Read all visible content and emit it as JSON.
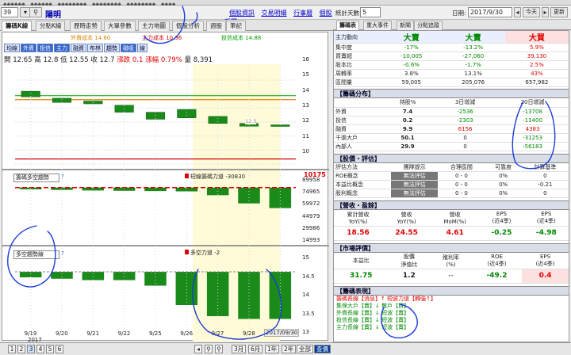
{
  "topbar": {
    "items": [
      "◆◆◆◆◆◆",
      "◆◆◆◆◆◆",
      "◆◆◆◆◆◆◆◆",
      "◆◆◆◆◆◆◆◆",
      "◆◆◆◆◆◆◆◆",
      "◆◆◆◆"
    ]
  },
  "header": {
    "code": "39",
    "stock_name": "陽明",
    "links": [
      "個股資訊",
      "交易明細",
      "行事曆",
      "個股新聞"
    ]
  },
  "left_tabs": [
    "籌碼K線",
    "分點K線",
    "歷時走勢",
    "大單參數",
    "主力地圖",
    "個股分析",
    "週股",
    "筆記"
  ],
  "legend_top": [
    {
      "label": "外資成本 14.60",
      "color": "#e08000"
    },
    {
      "label": "主力成本 10.36",
      "color": "#d00000"
    },
    {
      "label": "投信成本 14.88",
      "color": "#00a000"
    }
  ],
  "chart_buttons": [
    "均線",
    "外資",
    "投信",
    "主力",
    "融資",
    "布林",
    "趨勢",
    "磁吸",
    "線"
  ],
  "quote": {
    "open": "開 12.65",
    "high": "高 12.8",
    "low": "低 12.55",
    "close": "收 12.7",
    "change": "漲跌 0.1",
    "pct": "漲幅 0.79%",
    "vol": "量 8,391"
  },
  "panel2": {
    "select": "籌碼多空趨勢",
    "help": "?",
    "title": "短線籌碼力道 -30830",
    "maxval": "10175"
  },
  "panel3": {
    "select": "多空趨勢線",
    "help": "?",
    "title": "多空力道 -2"
  },
  "axis1": [
    "16",
    "15",
    "14",
    "13",
    "12",
    "11",
    "10"
  ],
  "axis2": [
    "89958",
    "74965",
    "59972",
    "44979",
    "29986",
    "14993"
  ],
  "axis3": [
    "15",
    "14.5",
    "14",
    "13.5",
    "13"
  ],
  "chart_label_12_5": "12.5",
  "x_dates": [
    "9/19",
    "9/20",
    "9/21",
    "9/22",
    "9/25",
    "9/26",
    "9/27",
    "9/28",
    "9/29"
  ],
  "year_label": "2017",
  "end_date_label": "2017/09/30",
  "pages": [
    "1",
    "2",
    "3",
    "4",
    "5",
    "6"
  ],
  "ranges": [
    "3月",
    "6月",
    "1年",
    "2年",
    "全部",
    "查價"
  ],
  "right_top": {
    "label": "統計天數:",
    "days": "5",
    "date_label": "日期:",
    "date": "2017/9/30",
    "today": "今天",
    "refresh": "更新"
  },
  "right_tabs": [
    "籌碼表",
    "重大事件",
    "新聞",
    "分點追蹤"
  ],
  "summary": {
    "header": [
      "主力動向",
      "大賣",
      "大賣",
      "大買"
    ],
    "rows": [
      [
        "集中度",
        "-17%",
        "-13.2%",
        "5.9%"
      ],
      [
        "買賣超",
        "-10,005",
        "-27,060",
        "39,130"
      ],
      [
        "股本比",
        "-0.6%",
        "-1.7%",
        "2.5%"
      ],
      [
        "周轉率",
        "3.8%",
        "13.1%",
        "43%"
      ],
      [
        "區間量",
        "59,005",
        "205,076",
        "657,982"
      ]
    ]
  },
  "chip_dist": {
    "title": "【籌碼分布】",
    "cols": [
      "",
      "持股%",
      "3日增減",
      "20日增減"
    ],
    "rows": [
      [
        "外資",
        "7.4",
        "-2536",
        "-13708"
      ],
      [
        "投信",
        "0.2",
        "-2303",
        "-11400"
      ],
      [
        "融資",
        "9.9",
        "6156",
        "4383"
      ],
      [
        "千張大戶",
        "50.1",
        "0",
        "-31253"
      ],
      [
        "內部人",
        "29.9",
        "0",
        "-56183"
      ]
    ]
  },
  "eval": {
    "title": "【股價・評估】",
    "cols": [
      "評估方法",
      "團隊提示",
      "合理區間",
      "可靠度",
      "計算基準"
    ],
    "rows": [
      [
        "ROE概念",
        "無法評估",
        "0 - 0",
        "0%",
        "0"
      ],
      [
        "本益比概念",
        "無法評估",
        "0 - 0",
        "0%",
        "-0.21"
      ],
      [
        "股利概念",
        "無法評估",
        "0 - 0",
        "0%",
        "0"
      ]
    ]
  },
  "earnings": {
    "title": "【營收・盈餘】",
    "cols": [
      "累計營收\nYoY(%)",
      "營收\nYoY(%)",
      "營收\nMoM(%)",
      "EPS\n(近4季)",
      "EPS\n(近4季)"
    ],
    "values": [
      "18.56",
      "24.55",
      "4.61",
      "-0.25",
      "-4.98"
    ]
  },
  "market": {
    "title": "【市場評價】",
    "cols": [
      "本益比",
      "股價\n淨值比",
      "殖利率\n(%)",
      "ROE\n(近4季)",
      "EPS\n(近4季)"
    ],
    "values": [
      "31.75",
      "1.2",
      "--",
      "-49.2",
      "0.4"
    ]
  },
  "signals": {
    "title": "【籌碼表現】",
    "rows": [
      "籌碼長線【消息】↑ 短波力道【轉強↑】",
      "集保大戶【賣】↓ 散戶【買】",
      "外資長線【賣】↓ 短波【賣】",
      "投信長線【賣】↓ 短波【賣】",
      "主力長線【賣】↓ 短波【賣】"
    ]
  },
  "chart_data": {
    "type": "candlestick",
    "x": [
      "9/19",
      "9/20",
      "9/21",
      "9/22",
      "9/25",
      "9/26",
      "9/27",
      "9/28",
      "9/29"
    ],
    "ylim": [
      10,
      16
    ],
    "candles": [
      {
        "o": 15.2,
        "c": 14.8,
        "color": "green"
      },
      {
        "o": 14.7,
        "c": 14.4,
        "color": "green"
      },
      {
        "o": 14.5,
        "c": 14.3,
        "color": "green"
      },
      {
        "o": 14.2,
        "c": 13.7,
        "color": "green"
      },
      {
        "o": 13.7,
        "c": 13.2,
        "color": "green"
      },
      {
        "o": 13.9,
        "c": 13.3,
        "color": "green"
      },
      {
        "o": 13.4,
        "c": 12.9,
        "color": "green"
      },
      {
        "o": 12.9,
        "c": 12.7,
        "color": "green"
      },
      {
        "o": 12.8,
        "c": 12.7,
        "color": "green"
      }
    ],
    "ma_orange": 14.6,
    "ma_red": 10.36,
    "ma_green_start": 14.88,
    "panel2": {
      "ylim": [
        0,
        100000
      ],
      "values": [
        92000,
        91000,
        90000,
        89500,
        89000,
        88500,
        82000,
        68000,
        60000
      ]
    },
    "panel3": {
      "ylim": [
        12.8,
        15.2
      ],
      "values": [
        14.6,
        14.55,
        14.5,
        14.5,
        14.3,
        13.6,
        13.2,
        13.1,
        13.1
      ]
    }
  }
}
